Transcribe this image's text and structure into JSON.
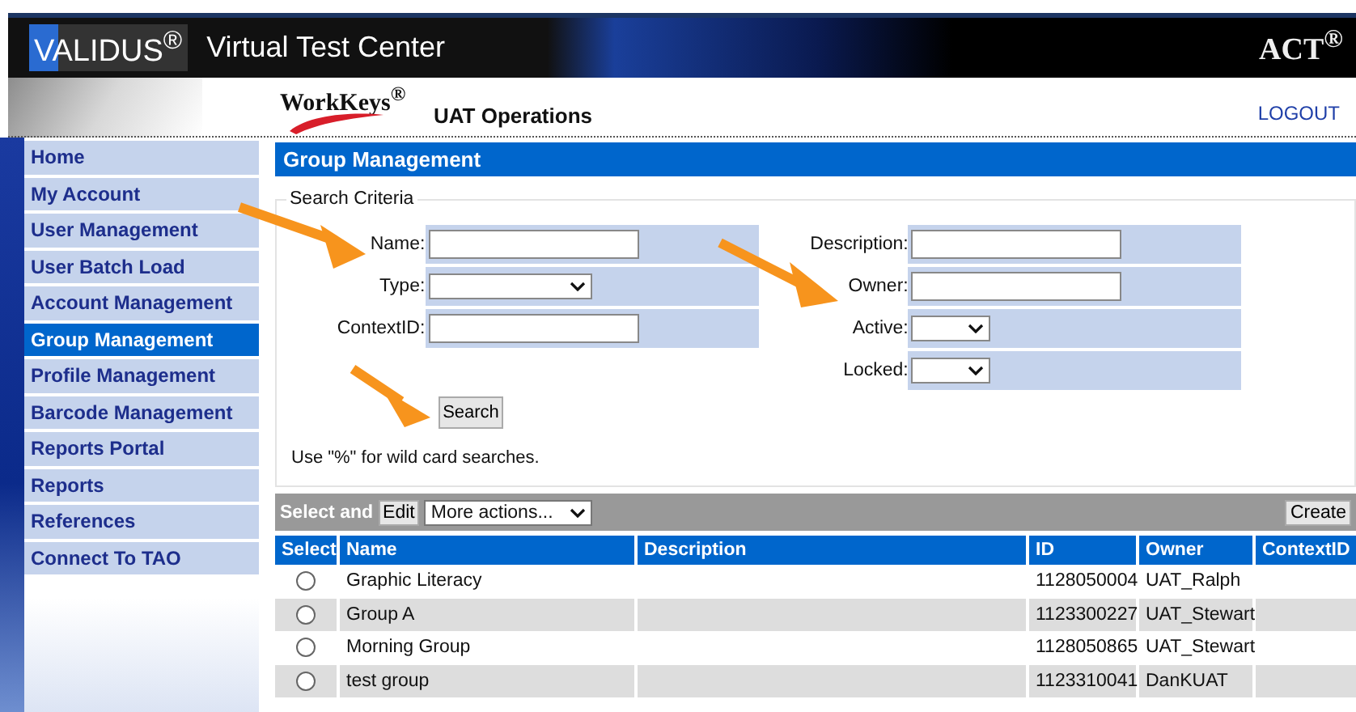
{
  "header": {
    "brand": "VALIDUS$^{®}$",
    "product": "Virtual Test Center",
    "partner": "ACT$^{®}$",
    "sub_brand": "WorkKeys$^{®}$",
    "environment": "UAT Operations",
    "logout": "LOGOUT"
  },
  "sidebar": {
    "items": [
      {
        "label": "Home",
        "selected": false
      },
      {
        "label": "My Account",
        "selected": false
      },
      {
        "label": "User Management",
        "selected": false
      },
      {
        "label": "User Batch Load",
        "selected": false
      },
      {
        "label": "Account Management",
        "selected": false
      },
      {
        "label": "Group Management",
        "selected": true
      },
      {
        "label": "Profile Management",
        "selected": false
      },
      {
        "label": "Barcode Management",
        "selected": false
      },
      {
        "label": "Reports Portal",
        "selected": false
      },
      {
        "label": "Reports",
        "selected": false
      },
      {
        "label": "References",
        "selected": false
      },
      {
        "label": "Connect To TAO",
        "selected": false
      }
    ]
  },
  "page_title": "Group Management",
  "search": {
    "legend": "Search Criteria",
    "left_fields": [
      {
        "label": "Name:",
        "kind": "text"
      },
      {
        "label": "Type:",
        "kind": "select"
      },
      {
        "label": "ContextID:",
        "kind": "text"
      }
    ],
    "right_fields": [
      {
        "label": "Description:",
        "kind": "text"
      },
      {
        "label": "Owner:",
        "kind": "text"
      },
      {
        "label": "Active:",
        "kind": "select"
      },
      {
        "label": "Locked:",
        "kind": "select"
      }
    ],
    "button": "Search",
    "hint": "Use \"%\" for wild card searches."
  },
  "toolbar": {
    "label": "Select and",
    "edit": "Edit",
    "actions": "More actions...",
    "create": "Create"
  },
  "table": {
    "columns": [
      "Select",
      "Name",
      "Description",
      "ID",
      "Owner",
      "ContextID"
    ],
    "rows": [
      {
        "name": "Graphic Literacy",
        "description": "",
        "id": "1128050004",
        "owner": "UAT_Ralph",
        "selected": false
      },
      {
        "name": "Group A",
        "description": "",
        "id": "1123300227",
        "owner": "UAT_Stewart",
        "selected": false
      },
      {
        "name": "Morning Group",
        "description": "",
        "id": "1128050865",
        "owner": "UAT_Stewart",
        "selected": false
      },
      {
        "name": "test group",
        "description": "",
        "id": "1123310041",
        "owner": "DanKUAT",
        "selected": false
      }
    ]
  }
}
